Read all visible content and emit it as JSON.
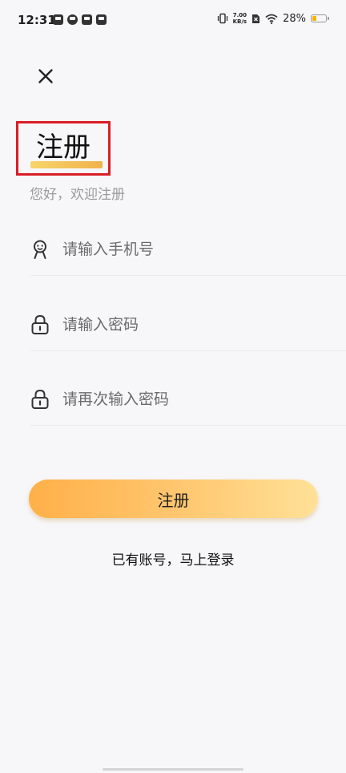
{
  "status_bar": {
    "time": "12:31",
    "net_speed_value": "7.00",
    "net_speed_unit": "KB/s",
    "battery_percent": "28%",
    "battery_level": 0.28,
    "left_icons": [
      "mail-icon",
      "wallet-icon",
      "tiktok-icon",
      "chat-icon"
    ],
    "right_icons": [
      "vibrate-icon",
      "sim-off-icon",
      "wifi-icon",
      "battery-icon"
    ]
  },
  "header": {
    "close_icon": "close-icon",
    "title": "注册",
    "subtitle": "您好，欢迎注册"
  },
  "form": {
    "phone": {
      "icon": "user-icon",
      "placeholder": "请输入手机号",
      "value": ""
    },
    "password": {
      "icon": "lock-icon",
      "placeholder": "请输入密码",
      "value": ""
    },
    "confirm_password": {
      "icon": "lock-icon",
      "placeholder": "请再次输入密码",
      "value": ""
    },
    "submit_label": "注册",
    "login_link": "已有账号，马上登录"
  },
  "colors": {
    "accent_start": "#ffb048",
    "accent_end": "#ffe197",
    "highlight_border": "#d81e25",
    "title_underline": "#f0b24c"
  }
}
